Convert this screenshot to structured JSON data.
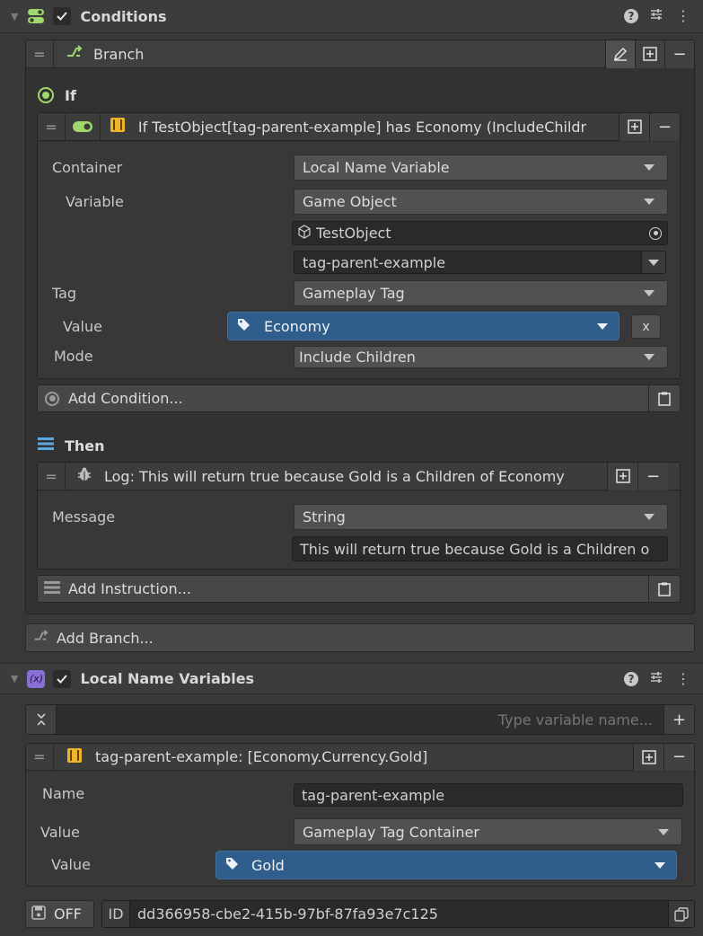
{
  "conditions": {
    "title": "Conditions",
    "branch": {
      "title": "Branch",
      "if_label": "If",
      "condition": {
        "title": "If TestObject[tag-parent-example] has Economy (IncludeChildr",
        "container_label": "Container",
        "container_value": "Local Name Variable",
        "variable_label": "Variable",
        "variable_value": "Game Object",
        "object_value": "TestObject",
        "name_value": "tag-parent-example",
        "tag_label": "Tag",
        "tag_value": "Gameplay Tag",
        "value_label": "Value",
        "value_value": "Economy",
        "clear_label": "x",
        "mode_label": "Mode",
        "mode_value": "Include Children"
      },
      "add_condition": "Add Condition...",
      "then_label": "Then",
      "instruction": {
        "title": "Log: This will return true because Gold is a Children of Economy",
        "message_label": "Message",
        "message_type": "String",
        "message_value": "This will return true because Gold is a Children o"
      },
      "add_instruction": "Add Instruction..."
    },
    "add_branch": "Add Branch..."
  },
  "local_vars": {
    "title": "Local Name Variables",
    "icon_text": "(x)",
    "search_placeholder": "Type variable name...",
    "add_label": "+",
    "variable": {
      "title": "tag-parent-example: [Economy.Currency.Gold]",
      "name_label": "Name",
      "name_value": "tag-parent-example",
      "value_label": "Value",
      "value_type": "Gameplay Tag Container",
      "value_sub_label": "Value",
      "value_tag": "Gold"
    },
    "off_label": "OFF",
    "id_label": "ID",
    "id_value": "dd366958-cbe2-415b-97bf-87fa93e7c125"
  },
  "icons": {
    "help": "?",
    "drag": "=",
    "plus": "+",
    "minus": "−"
  },
  "colors": {
    "accent_green": "#9fd86b",
    "tag_blue": "#2f5d8c",
    "then_blue": "#5aa8e0",
    "bracket_yellow": "#f0b429",
    "var_purple": "#8a6fd8"
  }
}
